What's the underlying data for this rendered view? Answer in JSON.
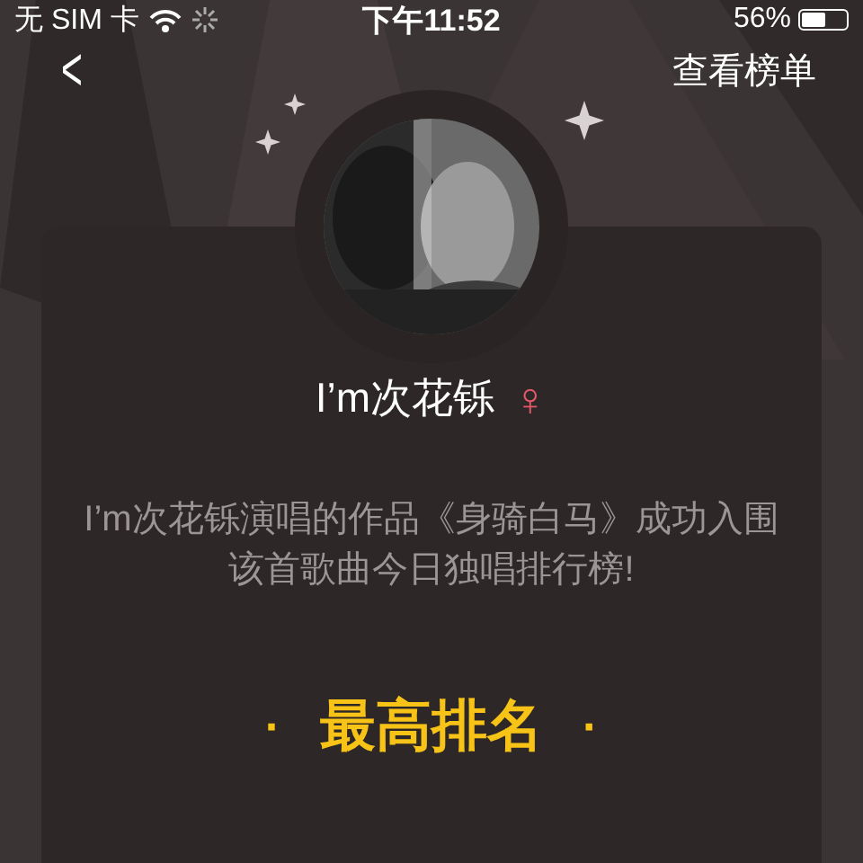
{
  "status_bar": {
    "carrier": "无 SIM 卡",
    "time": "下午11:52",
    "battery_text": "56%"
  },
  "nav": {
    "back": "<",
    "action": "查看榜单"
  },
  "card": {
    "name": "I’m次花铄",
    "gender_symbol": "♀",
    "description": "I’m次花铄演唱的作品《身骑白马》成功入围该首歌曲今日独唱排行榜!",
    "rank_title": "最高排名",
    "dot": "·"
  }
}
